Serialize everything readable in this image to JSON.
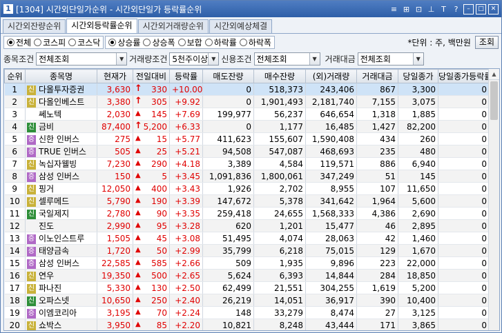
{
  "title": {
    "num": "1",
    "text": "[1304] 시간외단일가순위 - 시간외단일가 등락률순위"
  },
  "title_icons": [
    "≡",
    "⊞",
    "⊡",
    "⊥",
    "T",
    "?",
    "–",
    "□",
    "✕"
  ],
  "tabs": [
    {
      "label": "시간외잔량순위",
      "active": false
    },
    {
      "label": "시간외등락률순위",
      "active": true
    },
    {
      "label": "시간외거래량순위",
      "active": false
    },
    {
      "label": "시간외예상체결",
      "active": false
    }
  ],
  "market_options": [
    {
      "label": "전체",
      "selected": true
    },
    {
      "label": "코스피",
      "selected": false
    },
    {
      "label": "코스닥",
      "selected": false
    }
  ],
  "sort_options": [
    {
      "label": "상승률",
      "selected": true
    },
    {
      "label": "상승폭",
      "selected": false
    },
    {
      "label": "보합",
      "selected": false
    },
    {
      "label": "하락률",
      "selected": false
    },
    {
      "label": "하락폭",
      "selected": false
    }
  ],
  "unit_text": "*단위 : 주, 백만원",
  "search_button": "조회",
  "conditions": {
    "item_label": "종목조건",
    "item_value": "전체조회",
    "volume_label": "거래량조건",
    "volume_value": "5천주이상",
    "credit_label": "신용조건",
    "credit_value": "전체조회",
    "amount_label": "거래대금",
    "amount_value": "전체조회"
  },
  "columns": [
    "순위",
    "종목명",
    "현재가",
    "전일대비",
    "등락률",
    "매도잔량",
    "매수잔량",
    "(외)거래량",
    "거래대금",
    "당일종가",
    "당일종가등락률"
  ],
  "rows": [
    {
      "rank": "1",
      "badge": "신",
      "badge_type": "ko",
      "name": "다올투자증권",
      "price": "3,630",
      "arrow": "top",
      "change": "330",
      "rate": "+10.00",
      "ask": "0",
      "bid": "518,373",
      "volume": "243,406",
      "amount": "867",
      "close": "3,300",
      "close_rate": "0"
    },
    {
      "rank": "2",
      "badge": "신",
      "badge_type": "ko",
      "name": "다올인베스트",
      "price": "3,380",
      "arrow": "top",
      "change": "305",
      "rate": "+9.92",
      "ask": "0",
      "bid": "1,901,493",
      "volume": "2,181,740",
      "amount": "7,155",
      "close": "3,075",
      "close_rate": "0"
    },
    {
      "rank": "3",
      "badge": "",
      "badge_type": "",
      "name": "쎄노텍",
      "price": "2,030",
      "arrow": "up",
      "change": "145",
      "rate": "+7.69",
      "ask": "199,977",
      "bid": "56,237",
      "volume": "646,654",
      "amount": "1,318",
      "close": "1,885",
      "close_rate": "0"
    },
    {
      "rank": "4",
      "badge": "신",
      "badge_type": "new",
      "name": "금비",
      "price": "87,400",
      "arrow": "top",
      "change": "5,200",
      "rate": "+6.33",
      "ask": "0",
      "bid": "1,177",
      "volume": "16,485",
      "amount": "1,427",
      "close": "82,200",
      "close_rate": "0"
    },
    {
      "rank": "5",
      "badge": "증",
      "badge_type": "bond",
      "name": "신한 인버스",
      "price": "275",
      "arrow": "up",
      "change": "15",
      "rate": "+5.77",
      "ask": "411,623",
      "bid": "155,607",
      "volume": "1,590,408",
      "amount": "434",
      "close": "260",
      "close_rate": "0"
    },
    {
      "rank": "6",
      "badge": "증",
      "badge_type": "bond",
      "name": "TRUE 인버스",
      "price": "505",
      "arrow": "up",
      "change": "25",
      "rate": "+5.21",
      "ask": "94,508",
      "bid": "547,087",
      "volume": "468,693",
      "amount": "235",
      "close": "480",
      "close_rate": "0"
    },
    {
      "rank": "7",
      "badge": "신",
      "badge_type": "ko",
      "name": "녹십자웰빙",
      "price": "7,230",
      "arrow": "up",
      "change": "290",
      "rate": "+4.18",
      "ask": "3,389",
      "bid": "4,584",
      "volume": "119,571",
      "amount": "886",
      "close": "6,940",
      "close_rate": "0"
    },
    {
      "rank": "8",
      "badge": "증",
      "badge_type": "bond",
      "name": "삼성 인버스",
      "price": "150",
      "arrow": "up",
      "change": "5",
      "rate": "+3.45",
      "ask": "1,091,836",
      "bid": "1,800,061",
      "volume": "347,249",
      "amount": "51",
      "close": "145",
      "close_rate": "0"
    },
    {
      "rank": "9",
      "badge": "신",
      "badge_type": "ko",
      "name": "핑거",
      "price": "12,050",
      "arrow": "up",
      "change": "400",
      "rate": "+3.43",
      "ask": "1,926",
      "bid": "2,702",
      "volume": "8,955",
      "amount": "107",
      "close": "11,650",
      "close_rate": "0"
    },
    {
      "rank": "10",
      "badge": "신",
      "badge_type": "ko",
      "name": "셀루메드",
      "price": "5,790",
      "arrow": "up",
      "change": "190",
      "rate": "+3.39",
      "ask": "147,672",
      "bid": "5,378",
      "volume": "341,642",
      "amount": "1,964",
      "close": "5,600",
      "close_rate": "0"
    },
    {
      "rank": "11",
      "badge": "신",
      "badge_type": "new",
      "name": "국일제지",
      "price": "2,780",
      "arrow": "up",
      "change": "90",
      "rate": "+3.35",
      "ask": "259,418",
      "bid": "24,655",
      "volume": "1,568,333",
      "amount": "4,386",
      "close": "2,690",
      "close_rate": "0"
    },
    {
      "rank": "12",
      "badge": "",
      "badge_type": "",
      "name": "진도",
      "price": "2,990",
      "arrow": "up",
      "change": "95",
      "rate": "+3.28",
      "ask": "620",
      "bid": "1,201",
      "volume": "15,477",
      "amount": "46",
      "close": "2,895",
      "close_rate": "0"
    },
    {
      "rank": "13",
      "badge": "증",
      "badge_type": "bond",
      "name": "이노인스트루",
      "price": "1,505",
      "arrow": "up",
      "change": "45",
      "rate": "+3.08",
      "ask": "51,495",
      "bid": "4,074",
      "volume": "28,063",
      "amount": "42",
      "close": "1,460",
      "close_rate": "0"
    },
    {
      "rank": "14",
      "badge": "증",
      "badge_type": "bond",
      "name": "태양금속",
      "price": "1,720",
      "arrow": "up",
      "change": "50",
      "rate": "+2.99",
      "ask": "35,799",
      "bid": "6,218",
      "volume": "75,015",
      "amount": "129",
      "close": "1,670",
      "close_rate": "0"
    },
    {
      "rank": "15",
      "badge": "증",
      "badge_type": "bond",
      "name": "삼성 인버스",
      "price": "22,585",
      "arrow": "up",
      "change": "585",
      "rate": "+2.66",
      "ask": "509",
      "bid": "1,935",
      "volume": "9,896",
      "amount": "223",
      "close": "22,000",
      "close_rate": "0"
    },
    {
      "rank": "16",
      "badge": "신",
      "badge_type": "ko",
      "name": "연우",
      "price": "19,350",
      "arrow": "up",
      "change": "500",
      "rate": "+2.65",
      "ask": "5,624",
      "bid": "6,393",
      "volume": "14,844",
      "amount": "284",
      "close": "18,850",
      "close_rate": "0"
    },
    {
      "rank": "17",
      "badge": "신",
      "badge_type": "ko",
      "name": "파나진",
      "price": "5,330",
      "arrow": "up",
      "change": "130",
      "rate": "+2.50",
      "ask": "62,499",
      "bid": "21,551",
      "volume": "304,255",
      "amount": "1,619",
      "close": "5,200",
      "close_rate": "0"
    },
    {
      "rank": "18",
      "badge": "신",
      "badge_type": "new",
      "name": "오파스넷",
      "price": "10,650",
      "arrow": "up",
      "change": "250",
      "rate": "+2.40",
      "ask": "26,219",
      "bid": "14,051",
      "volume": "36,917",
      "amount": "390",
      "close": "10,400",
      "close_rate": "0"
    },
    {
      "rank": "19",
      "badge": "증",
      "badge_type": "bond",
      "name": "이엠코리아",
      "price": "3,195",
      "arrow": "up",
      "change": "70",
      "rate": "+2.24",
      "ask": "148",
      "bid": "33,279",
      "volume": "8,474",
      "amount": "27",
      "close": "3,125",
      "close_rate": "0"
    },
    {
      "rank": "20",
      "badge": "신",
      "badge_type": "ko",
      "name": "쇼박스",
      "price": "3,950",
      "arrow": "up",
      "change": "85",
      "rate": "+2.20",
      "ask": "10,821",
      "bid": "8,248",
      "volume": "43,444",
      "amount": "171",
      "close": "3,865",
      "close_rate": "0"
    }
  ],
  "colors": {
    "up": "#e00000",
    "selected_row": "#cfe3f7",
    "title_bar": "#2e5fa8"
  }
}
